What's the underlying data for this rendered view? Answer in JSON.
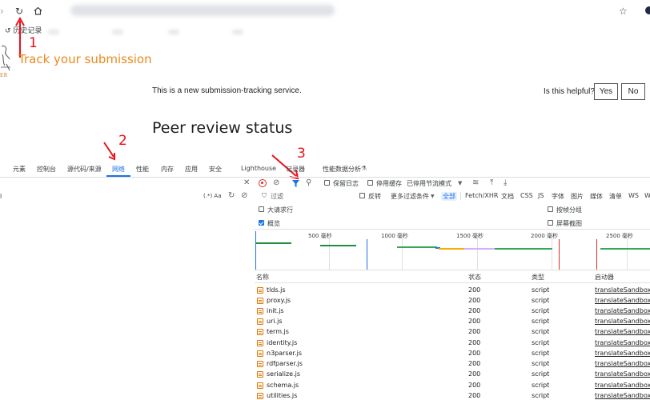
{
  "browser": {
    "reload_icon": "reload-icon",
    "home_icon": "home-icon",
    "star_icon": "star-icon",
    "history_label": "历史记录"
  },
  "annotations": {
    "n1": "1",
    "n2": "2",
    "n3": "3",
    "color": "#e8121b"
  },
  "site": {
    "track_title": "Track your submission",
    "logo_text": "ER",
    "notice": "This is a new submission-tracking service.",
    "helpful_question": "Is this helpful?",
    "yes_label": "Yes",
    "no_label": "No",
    "heading": "Peer review status",
    "accent_color": "#e98a1e"
  },
  "devtools": {
    "tabs": [
      "元素",
      "控制台",
      "源代码/来源",
      "网络",
      "性能",
      "内存",
      "应用",
      "安全",
      "Lighthouse",
      "记录器",
      "性能数据分析"
    ],
    "active_tab": "网络",
    "toolbar": {
      "preserve_log": "保留日志",
      "disable_cache": "停用缓存",
      "throttling": "已停用节流模式"
    },
    "filter": {
      "placeholder": "过滤",
      "invert": "反转",
      "more_filters": "更多过滤条件",
      "types": [
        "全部",
        "Fetch/XHR",
        "文档",
        "CSS",
        "JS",
        "字体",
        "图片",
        "媒体",
        "清单",
        "WS",
        "W"
      ],
      "active_type": "全部"
    },
    "options": {
      "big_rows": "大请求行",
      "group_by_frame": "按帧分组",
      "overview": "概览",
      "screenshots": "屏幕截图"
    },
    "timeline_ticks": [
      "500 毫秒",
      "1000 毫秒",
      "1500 毫秒",
      "2000 毫秒",
      "2500 毫秒"
    ],
    "columns": {
      "name": "名称",
      "status": "状态",
      "type": "类型",
      "initiator": "启动器"
    },
    "rows": [
      {
        "name": "tlds.js",
        "status": "200",
        "type": "script",
        "initiator": "translateSandbox.h"
      },
      {
        "name": "proxy.js",
        "status": "200",
        "type": "script",
        "initiator": "translateSandbox.h"
      },
      {
        "name": "init.js",
        "status": "200",
        "type": "script",
        "initiator": "translateSandbox.h"
      },
      {
        "name": "uri.js",
        "status": "200",
        "type": "script",
        "initiator": "translateSandbox.h"
      },
      {
        "name": "term.js",
        "status": "200",
        "type": "script",
        "initiator": "translateSandbox.h"
      },
      {
        "name": "identity.js",
        "status": "200",
        "type": "script",
        "initiator": "translateSandbox.h"
      },
      {
        "name": "n3parser.js",
        "status": "200",
        "type": "script",
        "initiator": "translateSandbox.h"
      },
      {
        "name": "rdfparser.js",
        "status": "200",
        "type": "script",
        "initiator": "translateSandbox.h"
      },
      {
        "name": "serialize.js",
        "status": "200",
        "type": "script",
        "initiator": "translateSandbox.h"
      },
      {
        "name": "schema.js",
        "status": "200",
        "type": "script",
        "initiator": "translateSandbox.h"
      },
      {
        "name": "utilities.js",
        "status": "200",
        "type": "script",
        "initiator": "translateSandbox.h"
      }
    ]
  }
}
